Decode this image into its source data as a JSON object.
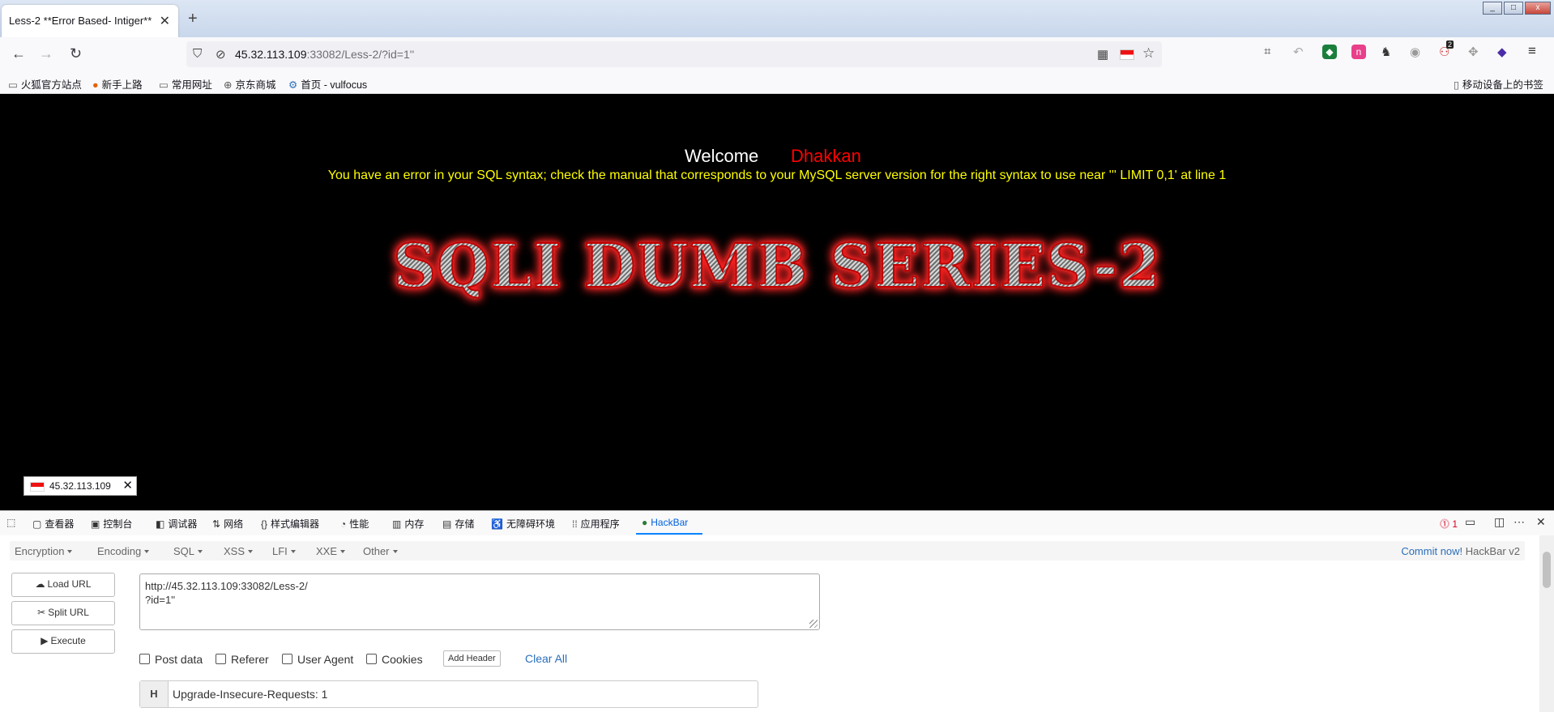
{
  "browser": {
    "tab_title": "Less-2 **Error Based- Intiger**",
    "tab_close": "✕",
    "new_tab": "+",
    "url_host": "45.32.113.109",
    "url_rest": ":33082/Less-2/?id=1''",
    "bookmarks": [
      "火狐官方站点",
      "新手上路",
      "常用网址",
      "京东商城",
      "首页 - vulfocus"
    ],
    "mobile_bookmarks": "移动设备上的书签",
    "extension_badge": "2"
  },
  "page": {
    "welcome": "Welcome",
    "name": "Dhakkan",
    "sql_error": "You have an error in your SQL syntax; check the manual that corresponds to your MySQL server version for the right syntax to use near ''' LIMIT 0,1' at line 1",
    "banner": "SQLI DUMB SERIES-2",
    "ip_pill": "45.32.113.109",
    "ip_close": "✕"
  },
  "devtools": {
    "tabs": [
      "查看器",
      "控制台",
      "调试器",
      "网络",
      "样式编辑器",
      "性能",
      "内存",
      "存储",
      "无障碍环境",
      "应用程序",
      "HackBar"
    ],
    "error_count": "1",
    "close": "✕"
  },
  "hackbar": {
    "menus": [
      "Encryption",
      "Encoding",
      "SQL",
      "XSS",
      "LFI",
      "XXE",
      "Other"
    ],
    "commit_link": "Commit now!",
    "version": "HackBar v2",
    "buttons": [
      "Load URL",
      "Split URL",
      "Execute"
    ],
    "url_line1": "http://45.32.113.109:33082/Less-2/",
    "url_line2": "?id=1''",
    "checkboxes": [
      "Post data",
      "Referer",
      "User Agent",
      "Cookies"
    ],
    "add_header": "Add Header",
    "clear_all": "Clear All",
    "header_key": "H",
    "header_value": "Upgrade-Insecure-Requests: 1"
  },
  "colors": {
    "page_bg": "#000000",
    "welcome_name": "#ff0000",
    "sql_error": "#ffff00",
    "hackbar_active": "#0060df",
    "link": "#2a6ebb"
  },
  "icons": [
    "back-icon",
    "forward-icon",
    "reload-icon",
    "shield-icon",
    "lock-icon",
    "qr-icon",
    "flag-icon",
    "star-icon",
    "menu-icon"
  ]
}
